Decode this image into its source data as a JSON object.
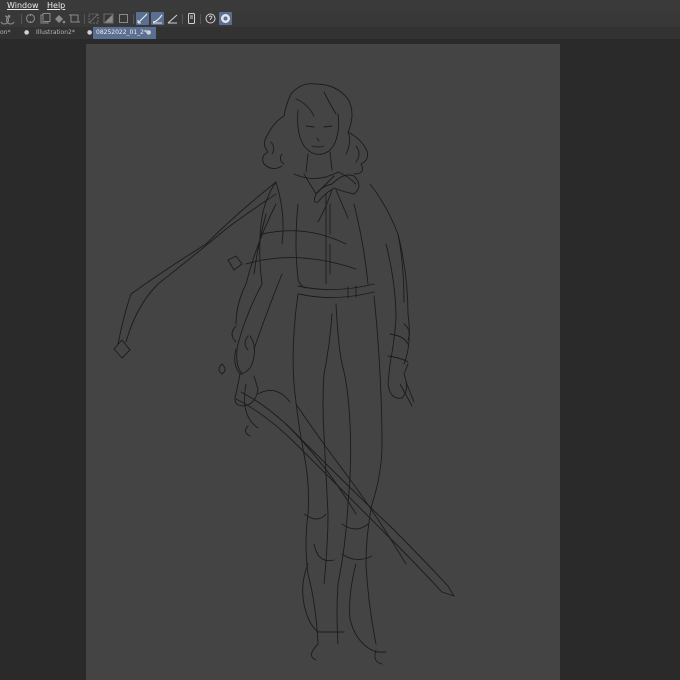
{
  "menubar": {
    "items": [
      "Window",
      "Help"
    ]
  },
  "toolbar": {
    "buttons": [
      {
        "icon": "undo-icon",
        "active": false
      },
      {
        "icon": "redo-icon",
        "active": false
      },
      {
        "icon": "transform-icon",
        "active": false
      },
      {
        "icon": "copy-icon",
        "active": false
      },
      {
        "icon": "fill-icon",
        "active": false
      },
      {
        "icon": "crop-icon",
        "active": false
      },
      {
        "icon": "clear-selection-icon",
        "active": false
      },
      {
        "icon": "invert-selection-icon",
        "active": false
      },
      {
        "icon": "selection-border-icon",
        "active": false
      },
      {
        "icon": "pen-snap-icon",
        "active": true
      },
      {
        "icon": "ruler-snap-icon",
        "active": true
      },
      {
        "icon": "special-ruler-icon",
        "active": false
      },
      {
        "icon": "device-icon",
        "active": false
      },
      {
        "icon": "help-icon",
        "active": false
      },
      {
        "icon": "color-circle-icon",
        "active": true
      }
    ]
  },
  "tabs": [
    {
      "label": "on*",
      "active": false
    },
    {
      "label": "Illustration2*",
      "active": false
    },
    {
      "label": "08252022_01_2*",
      "active": true
    }
  ],
  "colors": {
    "canvas": "#444444",
    "workspace": "#2a2a2a",
    "accent": "#5b6f92",
    "sketch": "#151515"
  }
}
